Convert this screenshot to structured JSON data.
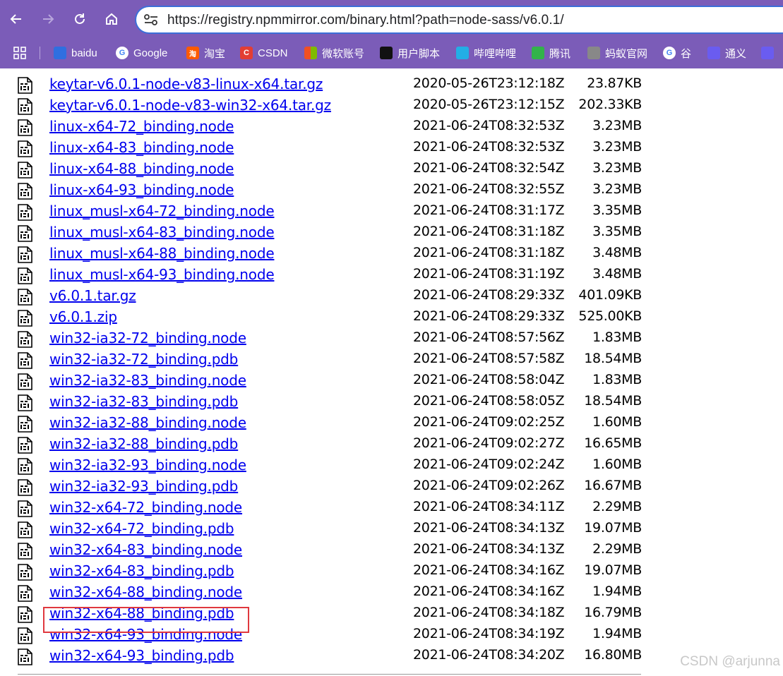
{
  "browser": {
    "url": "https://registry.npmmirror.com/binary.html?path=node-sass/v6.0.1/",
    "bookmarks": [
      {
        "label": "baidu",
        "icon": "paw-icon",
        "color": "#2f6fe0"
      },
      {
        "label": "Google",
        "icon": "google-icon",
        "color": "#ffffff"
      },
      {
        "label": "淘宝",
        "icon": "taobao-icon",
        "color": "#ff5a00"
      },
      {
        "label": "CSDN",
        "icon": "csdn-icon",
        "color": "#e33e33"
      },
      {
        "label": "微软账号",
        "icon": "microsoft-icon",
        "color": "#ffffff"
      },
      {
        "label": "用户脚本",
        "icon": "script-icon",
        "color": "#111111"
      },
      {
        "label": "哔哩哔哩",
        "icon": "bilibili-icon",
        "color": "#23aee5"
      },
      {
        "label": "腾讯",
        "icon": "play-icon",
        "color": "#32b34a"
      },
      {
        "label": "蚂蚁官网",
        "icon": "globe-icon",
        "color": "#888888"
      },
      {
        "label": "谷",
        "icon": "google-icon",
        "color": "#ffffff"
      },
      {
        "label": "通义",
        "icon": "tongyi-icon",
        "color": "#6a5cf0"
      },
      {
        "label": "",
        "icon": "extra-icon",
        "color": "#6a5cf0"
      }
    ]
  },
  "files": [
    {
      "name": "keytar-v6.0.1-node-v83-linux-x64.tar.gz",
      "date": "2020-05-26T23:12:18Z",
      "size": "23.87KB"
    },
    {
      "name": "keytar-v6.0.1-node-v83-win32-x64.tar.gz",
      "date": "2020-05-26T23:12:15Z",
      "size": "202.33KB"
    },
    {
      "name": "linux-x64-72_binding.node",
      "date": "2021-06-24T08:32:53Z",
      "size": "3.23MB"
    },
    {
      "name": "linux-x64-83_binding.node",
      "date": "2021-06-24T08:32:53Z",
      "size": "3.23MB"
    },
    {
      "name": "linux-x64-88_binding.node",
      "date": "2021-06-24T08:32:54Z",
      "size": "3.23MB"
    },
    {
      "name": "linux-x64-93_binding.node",
      "date": "2021-06-24T08:32:55Z",
      "size": "3.23MB"
    },
    {
      "name": "linux_musl-x64-72_binding.node",
      "date": "2021-06-24T08:31:17Z",
      "size": "3.35MB"
    },
    {
      "name": "linux_musl-x64-83_binding.node",
      "date": "2021-06-24T08:31:18Z",
      "size": "3.35MB"
    },
    {
      "name": "linux_musl-x64-88_binding.node",
      "date": "2021-06-24T08:31:18Z",
      "size": "3.48MB"
    },
    {
      "name": "linux_musl-x64-93_binding.node",
      "date": "2021-06-24T08:31:19Z",
      "size": "3.48MB"
    },
    {
      "name": "v6.0.1.tar.gz",
      "date": "2021-06-24T08:29:33Z",
      "size": "401.09KB"
    },
    {
      "name": "v6.0.1.zip",
      "date": "2021-06-24T08:29:33Z",
      "size": "525.00KB"
    },
    {
      "name": "win32-ia32-72_binding.node",
      "date": "2021-06-24T08:57:56Z",
      "size": "1.83MB"
    },
    {
      "name": "win32-ia32-72_binding.pdb",
      "date": "2021-06-24T08:57:58Z",
      "size": "18.54MB"
    },
    {
      "name": "win32-ia32-83_binding.node",
      "date": "2021-06-24T08:58:04Z",
      "size": "1.83MB"
    },
    {
      "name": "win32-ia32-83_binding.pdb",
      "date": "2021-06-24T08:58:05Z",
      "size": "18.54MB"
    },
    {
      "name": "win32-ia32-88_binding.node",
      "date": "2021-06-24T09:02:25Z",
      "size": "1.60MB"
    },
    {
      "name": "win32-ia32-88_binding.pdb",
      "date": "2021-06-24T09:02:27Z",
      "size": "16.65MB"
    },
    {
      "name": "win32-ia32-93_binding.node",
      "date": "2021-06-24T09:02:24Z",
      "size": "1.60MB"
    },
    {
      "name": "win32-ia32-93_binding.pdb",
      "date": "2021-06-24T09:02:26Z",
      "size": "16.67MB"
    },
    {
      "name": "win32-x64-72_binding.node",
      "date": "2021-06-24T08:34:11Z",
      "size": "2.29MB"
    },
    {
      "name": "win32-x64-72_binding.pdb",
      "date": "2021-06-24T08:34:13Z",
      "size": "19.07MB"
    },
    {
      "name": "win32-x64-83_binding.node",
      "date": "2021-06-24T08:34:13Z",
      "size": "2.29MB",
      "highlighted": true
    },
    {
      "name": "win32-x64-83_binding.pdb",
      "date": "2021-06-24T08:34:16Z",
      "size": "19.07MB"
    },
    {
      "name": "win32-x64-88_binding.node",
      "date": "2021-06-24T08:34:16Z",
      "size": "1.94MB"
    },
    {
      "name": "win32-x64-88_binding.pdb",
      "date": "2021-06-24T08:34:18Z",
      "size": "16.79MB"
    },
    {
      "name": "win32-x64-93_binding.node",
      "date": "2021-06-24T08:34:19Z",
      "size": "1.94MB"
    },
    {
      "name": "win32-x64-93_binding.pdb",
      "date": "2021-06-24T08:34:20Z",
      "size": "16.80MB"
    }
  ],
  "watermark": "CSDN @arjunna",
  "colors": {
    "chrome": "#7b5cb8",
    "link": "#0000ee",
    "highlight": "#e0383e"
  }
}
